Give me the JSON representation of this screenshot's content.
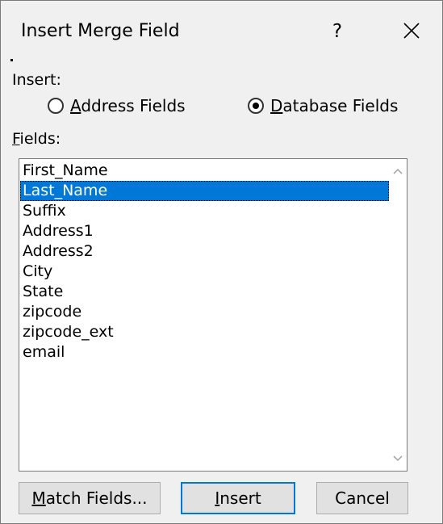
{
  "dialog": {
    "title": "Insert Merge Field",
    "help_label": "?"
  },
  "insert_group": {
    "label": "Insert:",
    "options": [
      {
        "access_key": "A",
        "rest": "ddress Fields",
        "checked": false
      },
      {
        "access_key": "D",
        "rest": "atabase Fields",
        "checked": true
      }
    ]
  },
  "fields": {
    "label_key": "F",
    "label_rest": "ields:",
    "items": [
      "First_Name",
      "Last_Name",
      "Suffix",
      "Address1",
      "Address2",
      "City",
      "State",
      "zipcode",
      "zipcode_ext",
      "email"
    ],
    "selected_index": 1
  },
  "buttons": {
    "match_key": "M",
    "match_rest": "atch Fields...",
    "insert_key": "I",
    "insert_rest": "nsert",
    "cancel": "Cancel"
  },
  "colors": {
    "selection": "#0078d7",
    "dialog_bg": "#f0f0f0"
  },
  "icons": {
    "close": "close-icon",
    "scroll_up": "chevron-up-icon",
    "scroll_down": "chevron-down-icon"
  }
}
